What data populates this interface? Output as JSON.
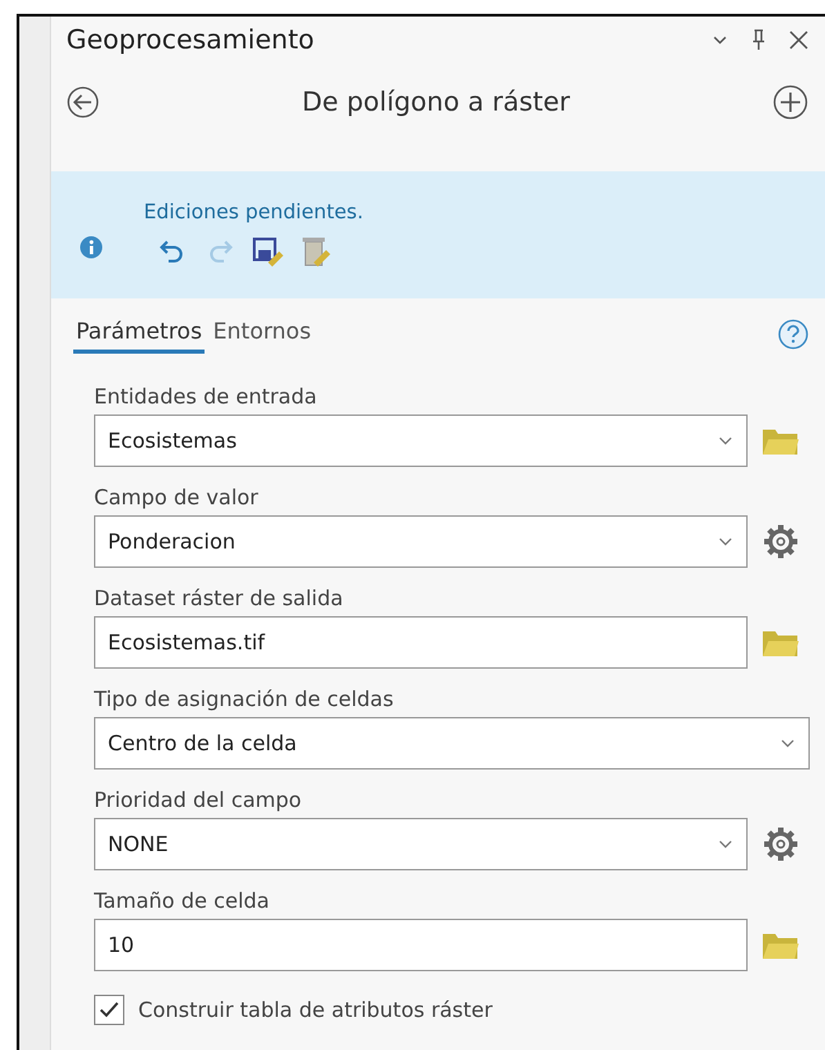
{
  "pane": {
    "title": "Geoprocesamiento"
  },
  "tool": {
    "title": "De polígono a ráster"
  },
  "banner": {
    "message": "Ediciones pendientes.",
    "undo_disabled": false,
    "redo_disabled": true
  },
  "tabs": [
    {
      "label": "Parámetros",
      "selected": true
    },
    {
      "label": "Entornos",
      "selected": false
    }
  ],
  "parameters": [
    {
      "kind": "dropdown",
      "label": "Entidades de entrada",
      "value": "Ecosistemas",
      "browse": true,
      "settings": false
    },
    {
      "kind": "dropdown",
      "label": "Campo de valor",
      "value": "Ponderacion",
      "browse": false,
      "settings": true
    },
    {
      "kind": "text",
      "label": "Dataset ráster de salida",
      "value": "Ecosistemas.tif",
      "browse": true,
      "settings": false
    },
    {
      "kind": "dropdown",
      "label": "Tipo de asignación de celdas",
      "value": "Centro de la celda",
      "browse": false,
      "settings": false
    },
    {
      "kind": "dropdown",
      "label": "Prioridad del campo",
      "value": "NONE",
      "browse": false,
      "settings": true
    },
    {
      "kind": "text",
      "label": "Tamaño de celda",
      "value": "10",
      "browse": true,
      "settings": false
    },
    {
      "kind": "checkbox",
      "label": "Construir tabla de atributos ráster",
      "checked": true
    }
  ]
}
